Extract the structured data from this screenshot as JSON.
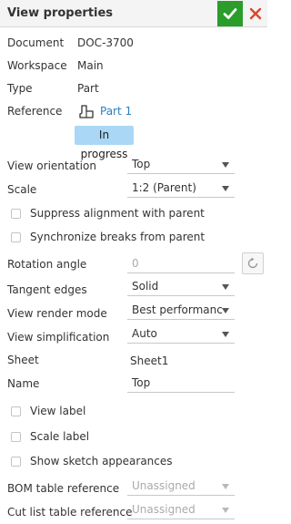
{
  "header": {
    "title": "View properties",
    "ok_icon": "check-icon",
    "close_icon": "close-icon"
  },
  "info": {
    "document_label": "Document",
    "document_value": "DOC-3700",
    "workspace_label": "Workspace",
    "workspace_value": "Main",
    "type_label": "Type",
    "type_value": "Part",
    "reference_label": "Reference",
    "reference_value": "Part 1",
    "status": "In progress"
  },
  "view_orientation": {
    "label": "View orientation",
    "value": "Top"
  },
  "scale": {
    "label": "Scale",
    "value": "1:2 (Parent)"
  },
  "suppress_alignment": {
    "label": "Suppress alignment with parent",
    "checked": false
  },
  "synchronize_breaks": {
    "label": "Synchronize breaks from parent",
    "checked": false
  },
  "rotation_angle": {
    "label": "Rotation angle",
    "value": "0"
  },
  "tangent_edges": {
    "label": "Tangent edges",
    "value": "Solid"
  },
  "render_mode": {
    "label": "View render mode",
    "value": "Best performance"
  },
  "simplification": {
    "label": "View simplification",
    "value": "Auto"
  },
  "sheet": {
    "label": "Sheet",
    "value": "Sheet1"
  },
  "name": {
    "label": "Name",
    "value": "Top"
  },
  "view_label": {
    "label": "View label",
    "checked": false
  },
  "scale_label": {
    "label": "Scale label",
    "checked": false
  },
  "sketch_appearances": {
    "label": "Show sketch appearances",
    "checked": false
  },
  "bom_table": {
    "label": "BOM table reference",
    "value": "Unassigned"
  },
  "cut_list_table": {
    "label": "Cut list table reference",
    "value": "Unassigned"
  },
  "colors": {
    "accent": "#2a9d2a",
    "close": "#d9472b",
    "link": "#2a7fc0",
    "status_bg": "#a9d7f5"
  }
}
